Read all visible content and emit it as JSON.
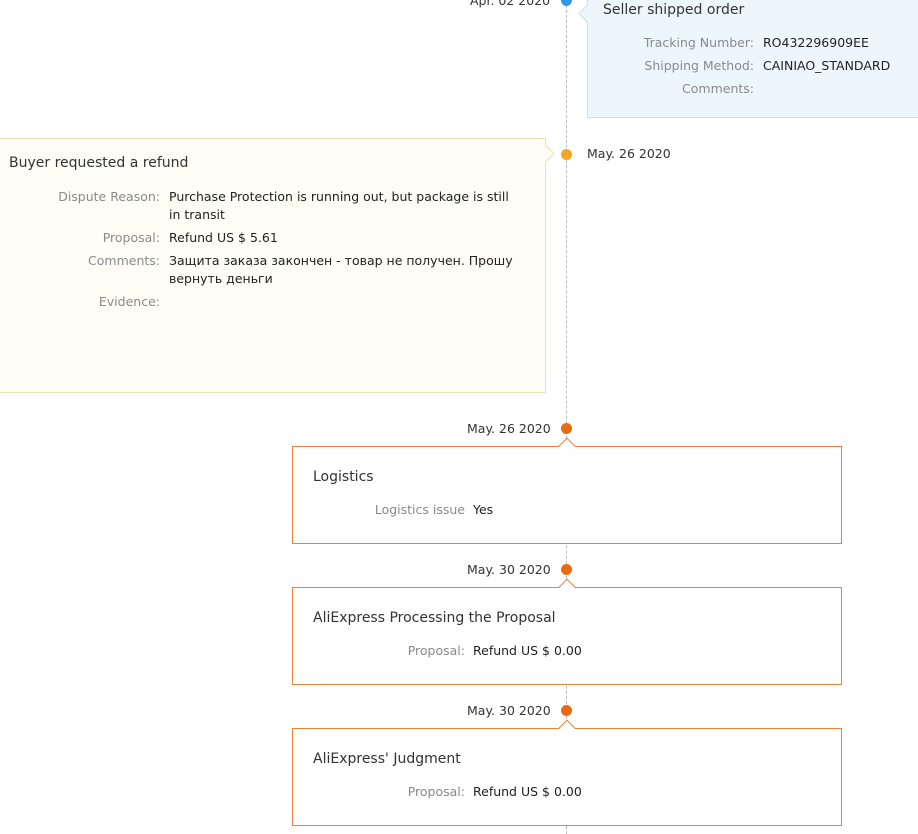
{
  "colors": {
    "seller_dot": "#2f9ae8",
    "buyer_dot": "#f5a623",
    "platform_dot": "#ea6a12",
    "orange_border": "#e5823e"
  },
  "events": {
    "seller_shipped": {
      "date": "Apr. 02 2020",
      "title": "Seller shipped order",
      "tracking_label": "Tracking Number:",
      "tracking_value": "RO432296909EE",
      "method_label": "Shipping Method:",
      "method_value": "CAINIAO_STANDARD",
      "comments_label": "Comments:",
      "comments_value": ""
    },
    "buyer_refund": {
      "date": "May. 26 2020",
      "title": "Buyer requested a refund",
      "reason_label": "Dispute Reason:",
      "reason_value": "Purchase Protection is running out, but package is still in transit",
      "proposal_label": "Proposal:",
      "proposal_value": "Refund US $ 5.61",
      "comments_label": "Comments:",
      "comments_value": "Защита заказа закончен - товар не получен. Прошу вернуть деньги",
      "evidence_label": "Evidence:",
      "evidence_value": ""
    },
    "logistics": {
      "date": "May. 26 2020",
      "title": "Logistics",
      "issue_label": "Logistics issue",
      "issue_value": "Yes"
    },
    "processing": {
      "date": "May. 30 2020",
      "title": "AliExpress Processing the Proposal",
      "proposal_label": "Proposal:",
      "proposal_value": "Refund US $ 0.00"
    },
    "judgment": {
      "date": "May. 30 2020",
      "title": "AliExpress' Judgment",
      "proposal_label": "Proposal:",
      "proposal_value": "Refund US $ 0.00"
    }
  }
}
